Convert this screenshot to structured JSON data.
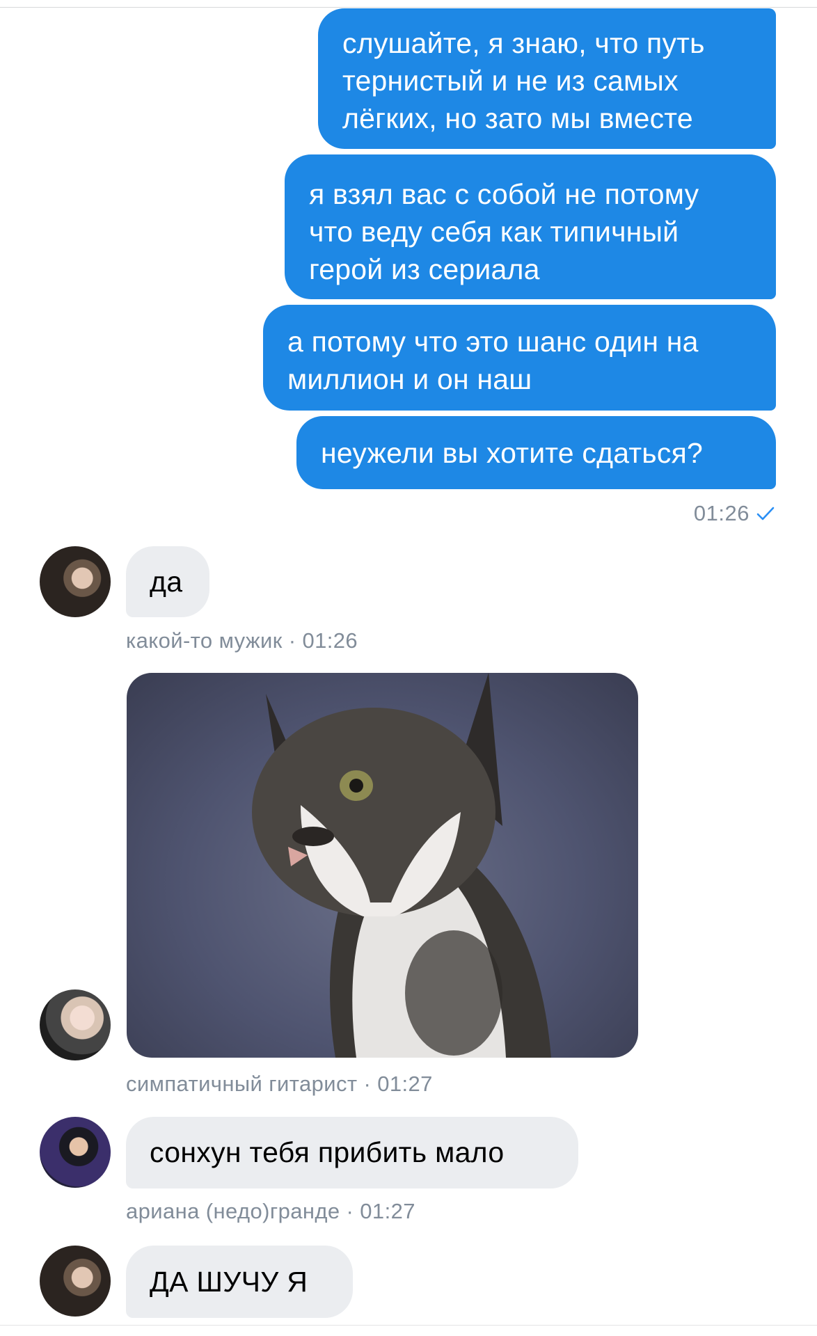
{
  "outgoing": {
    "messages": [
      "слушайте, я знаю, что путь\nтернистый и не из самых\nлёгких, но зато мы вместе",
      "я взял вас с собой не потому\nчто веду себя как типичный\nгерой из сериала",
      "а потому что это шанс один на\nмиллион и он наш",
      "неужели вы хотите сдаться?"
    ],
    "time": "01:26",
    "status_icon": "check-icon"
  },
  "incoming": [
    {
      "text": "да",
      "sender": "какой-то мужик",
      "time": "01:26"
    },
    {
      "image": "cat-photo",
      "sender": "симпатичный гитарист",
      "time": "01:27"
    },
    {
      "text": "сонхун тебя прибить мало",
      "sender": "ариана (недо)гранде ",
      "time": "01:27"
    },
    {
      "text": "ДА ШУЧУ Я"
    }
  ],
  "colors": {
    "outgoing_bubble": "#1e88e5",
    "incoming_bubble": "#ebedf0",
    "meta_text": "#818c99",
    "check": "#2a8ff5"
  }
}
